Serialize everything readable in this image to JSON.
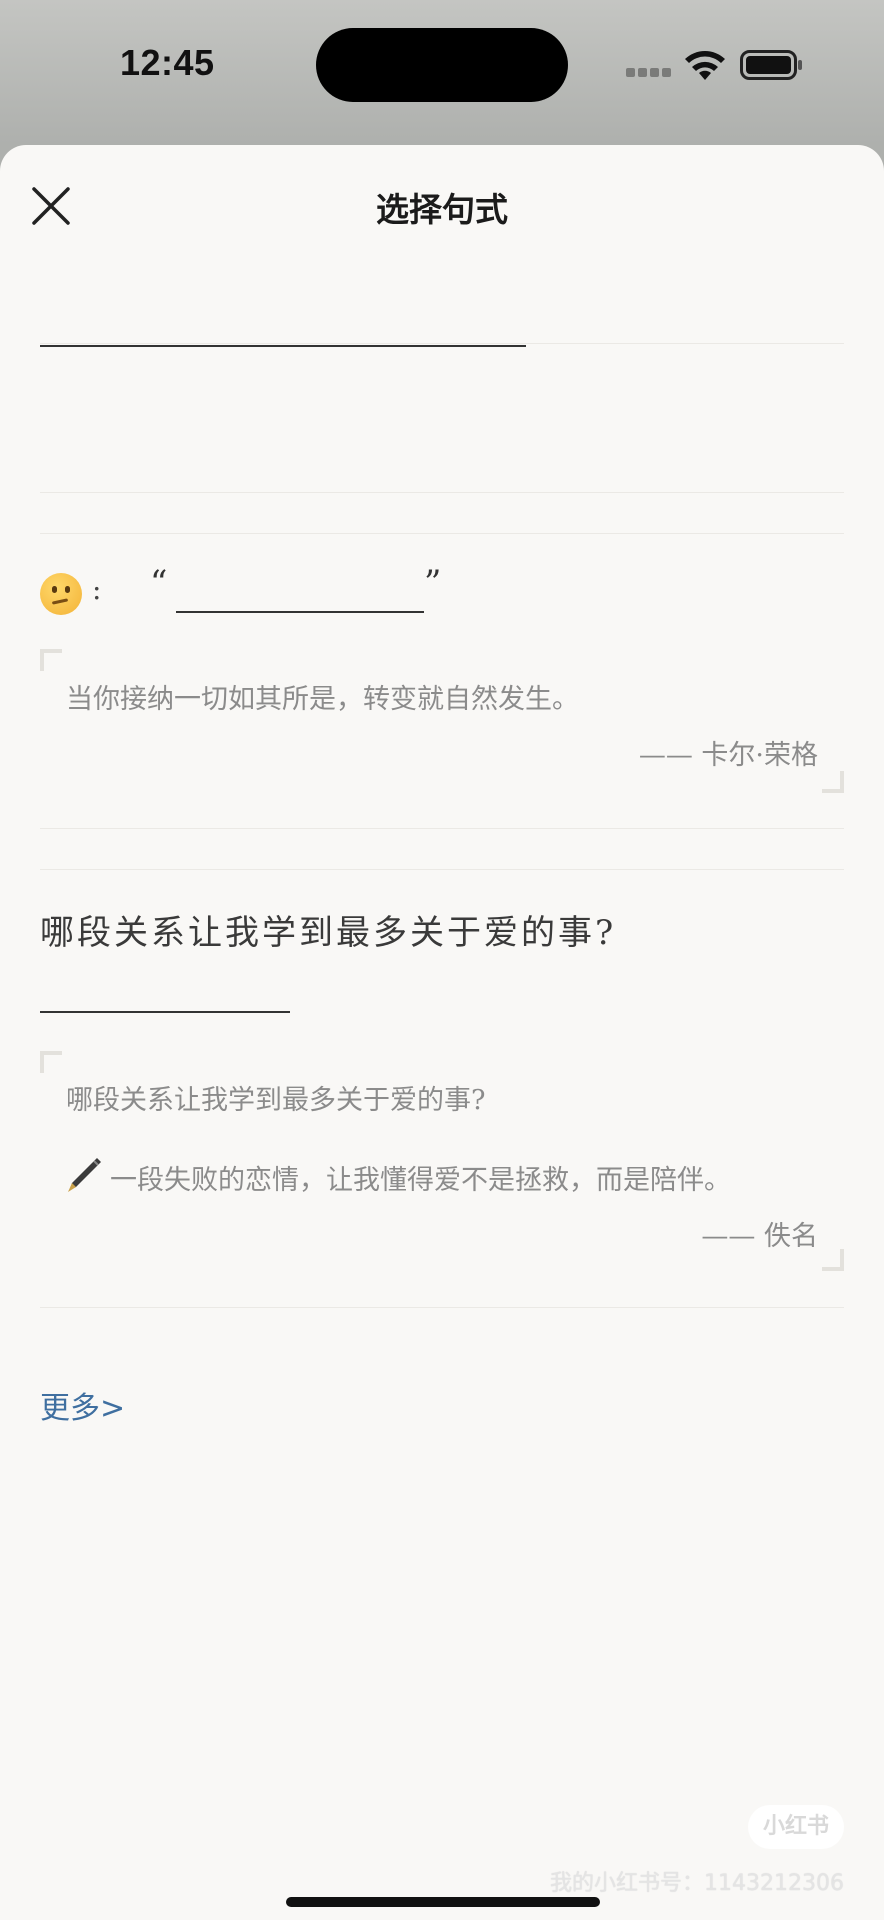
{
  "status_bar": {
    "time": "12:45"
  },
  "sheet": {
    "title": "选择句式"
  },
  "template_2": {
    "colon": ":",
    "quote_open": "“",
    "quote_close": "”",
    "example_text": "当你接纳一切如其所是，转变就自然发生。",
    "example_author": "—— 卡尔·荣格"
  },
  "template_3": {
    "question": "哪段关系让我学到最多关于爱的事?",
    "example_question": "哪段关系让我学到最多关于爱的事?",
    "example_answer": "一段失败的恋情，让我懂得爱不是拯救，而是陪伴。",
    "example_author": "—— 佚名"
  },
  "more_link": "更多>",
  "watermark": {
    "badge": "小红书",
    "text": "我的小红书号：1143212306"
  },
  "icons": {
    "close": "close-icon",
    "emoji": "thinking-face-icon",
    "pen": "fountain-pen-icon",
    "wifi": "wifi-icon",
    "battery": "battery-icon",
    "signal": "signal-icon"
  },
  "colors": {
    "link": "#3f6fa0",
    "sheet_bg": "#f9f8f6",
    "example_text": "#8b8b8b"
  }
}
